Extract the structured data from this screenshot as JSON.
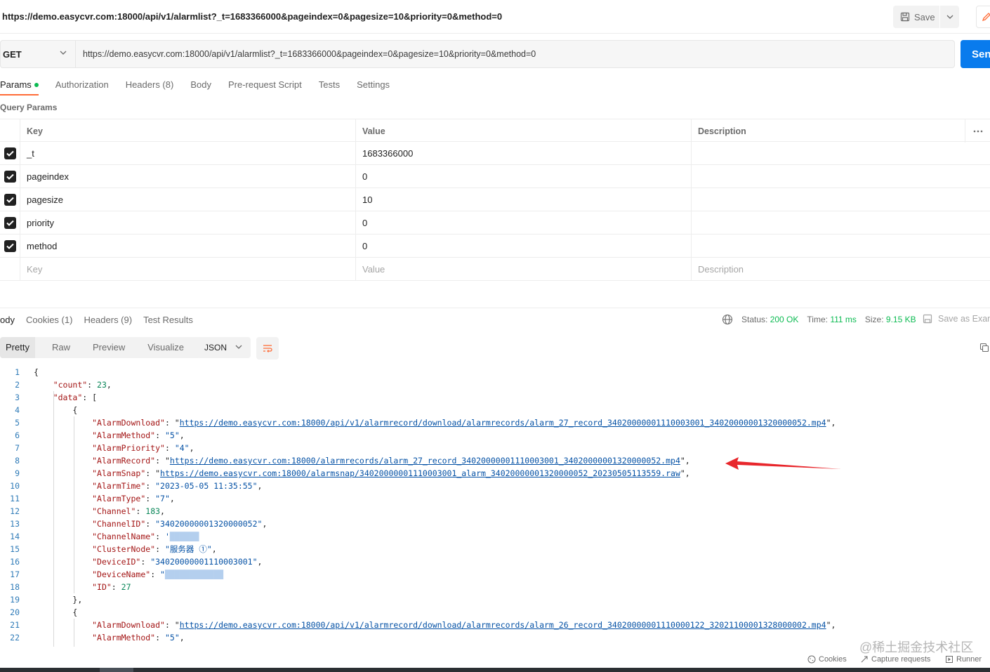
{
  "title_url": "https://demo.easycvr.com:18000/api/v1/alarmlist?_t=1683366000&pageindex=0&pagesize=10&priority=0&method=0",
  "toolbar": {
    "save_label": "Save"
  },
  "request": {
    "method": "GET",
    "url": "https://demo.easycvr.com:18000/api/v1/alarmlist?_t=1683366000&pageindex=0&pagesize=10&priority=0&method=0",
    "send_label": "Send"
  },
  "request_tabs": [
    "Params",
    "Authorization",
    "Headers (8)",
    "Body",
    "Pre-request Script",
    "Tests",
    "Settings"
  ],
  "query_params": {
    "title": "Query Params",
    "headers": {
      "key": "Key",
      "value": "Value",
      "description": "Description"
    },
    "rows": [
      {
        "key": "_t",
        "value": "1683366000"
      },
      {
        "key": "pageindex",
        "value": "0"
      },
      {
        "key": "pagesize",
        "value": "10"
      },
      {
        "key": "priority",
        "value": "0"
      },
      {
        "key": "method",
        "value": "0"
      }
    ],
    "placeholder": {
      "key": "Key",
      "value": "Value",
      "description": "Description"
    }
  },
  "response": {
    "tabs": [
      "ody",
      "Cookies (1)",
      "Headers (9)",
      "Test Results"
    ],
    "status_label": "Status:",
    "status_value": "200 OK",
    "time_label": "Time:",
    "time_value": "111 ms",
    "size_label": "Size:",
    "size_value": "9.15 KB",
    "save_example": "Save as Exam",
    "view_tabs": [
      "Pretty",
      "Raw",
      "Preview",
      "Visualize"
    ],
    "format": "JSON"
  },
  "code_lines": [
    {
      "n": "1",
      "indent": "",
      "tokens": [
        [
          "p",
          "{"
        ]
      ]
    },
    {
      "n": "2",
      "indent": "    ",
      "tokens": [
        [
          "k",
          "\"count\""
        ],
        [
          "p",
          ": "
        ],
        [
          "n",
          "23"
        ],
        [
          "p",
          ","
        ]
      ]
    },
    {
      "n": "3",
      "indent": "    ",
      "tokens": [
        [
          "k",
          "\"data\""
        ],
        [
          "p",
          ": ["
        ]
      ]
    },
    {
      "n": "4",
      "indent": "        ",
      "tokens": [
        [
          "p",
          "{"
        ]
      ]
    },
    {
      "n": "5",
      "indent": "            ",
      "tokens": [
        [
          "k",
          "\"AlarmDownload\""
        ],
        [
          "p",
          ": \""
        ],
        [
          "l",
          "https://demo.easycvr.com:18000/api/v1/alarmrecord/download/alarmrecords/alarm_27_record_34020000001110003001_34020000001320000052.mp4"
        ],
        [
          "p",
          "\","
        ]
      ]
    },
    {
      "n": "6",
      "indent": "            ",
      "tokens": [
        [
          "k",
          "\"AlarmMethod\""
        ],
        [
          "p",
          ": "
        ],
        [
          "s",
          "\"5\""
        ],
        [
          "p",
          ","
        ]
      ]
    },
    {
      "n": "7",
      "indent": "            ",
      "tokens": [
        [
          "k",
          "\"AlarmPriority\""
        ],
        [
          "p",
          ": "
        ],
        [
          "s",
          "\"4\""
        ],
        [
          "p",
          ","
        ]
      ]
    },
    {
      "n": "8",
      "indent": "            ",
      "tokens": [
        [
          "k",
          "\"AlarmRecord\""
        ],
        [
          "p",
          ": \""
        ],
        [
          "l",
          "https://demo.easycvr.com:18000/alarmrecords/alarm_27_record_34020000001110003001_34020000001320000052.mp4"
        ],
        [
          "p",
          "\","
        ]
      ]
    },
    {
      "n": "9",
      "indent": "            ",
      "tokens": [
        [
          "k",
          "\"AlarmSnap\""
        ],
        [
          "p",
          ": \""
        ],
        [
          "l",
          "https://demo.easycvr.com:18000/alarmsnap/34020000001110003001_alarm_34020000001320000052_20230505113559.raw"
        ],
        [
          "p",
          "\","
        ]
      ]
    },
    {
      "n": "10",
      "indent": "            ",
      "tokens": [
        [
          "k",
          "\"AlarmTime\""
        ],
        [
          "p",
          ": "
        ],
        [
          "s",
          "\"2023-05-05 11:35:55\""
        ],
        [
          "p",
          ","
        ]
      ]
    },
    {
      "n": "11",
      "indent": "            ",
      "tokens": [
        [
          "k",
          "\"AlarmType\""
        ],
        [
          "p",
          ": "
        ],
        [
          "s",
          "\"7\""
        ],
        [
          "p",
          ","
        ]
      ]
    },
    {
      "n": "12",
      "indent": "            ",
      "tokens": [
        [
          "k",
          "\"Channel\""
        ],
        [
          "p",
          ": "
        ],
        [
          "n",
          "183"
        ],
        [
          "p",
          ","
        ]
      ]
    },
    {
      "n": "13",
      "indent": "            ",
      "tokens": [
        [
          "k",
          "\"ChannelID\""
        ],
        [
          "p",
          ": "
        ],
        [
          "s",
          "\"34020000001320000052\""
        ],
        [
          "p",
          ","
        ]
      ]
    },
    {
      "n": "14",
      "indent": "            ",
      "tokens": [
        [
          "k",
          "\"ChannelName\""
        ],
        [
          "p",
          ": "
        ],
        [
          "s",
          "'"
        ],
        [
          "b",
          "██████"
        ]
      ]
    },
    {
      "n": "15",
      "indent": "            ",
      "tokens": [
        [
          "k",
          "\"ClusterNode\""
        ],
        [
          "p",
          ": "
        ],
        [
          "s",
          "\"服务器 ①\""
        ],
        [
          "p",
          ","
        ]
      ]
    },
    {
      "n": "16",
      "indent": "            ",
      "tokens": [
        [
          "k",
          "\"DeviceID\""
        ],
        [
          "p",
          ": "
        ],
        [
          "s",
          "\"34020000001110003001\""
        ],
        [
          "p",
          ","
        ]
      ]
    },
    {
      "n": "17",
      "indent": "            ",
      "tokens": [
        [
          "k",
          "\"DeviceName\""
        ],
        [
          "p",
          ": "
        ],
        [
          "s",
          "\""
        ],
        [
          "b",
          "████████████"
        ]
      ]
    },
    {
      "n": "18",
      "indent": "            ",
      "tokens": [
        [
          "k",
          "\"ID\""
        ],
        [
          "p",
          ": "
        ],
        [
          "n",
          "27"
        ]
      ]
    },
    {
      "n": "19",
      "indent": "        ",
      "tokens": [
        [
          "p",
          "},"
        ]
      ]
    },
    {
      "n": "20",
      "indent": "        ",
      "tokens": [
        [
          "p",
          "{"
        ]
      ]
    },
    {
      "n": "21",
      "indent": "            ",
      "tokens": [
        [
          "k",
          "\"AlarmDownload\""
        ],
        [
          "p",
          ": \""
        ],
        [
          "l",
          "https://demo.easycvr.com:18000/api/v1/alarmrecord/download/alarmrecords/alarm_26_record_34020000001110000122_32021100001328000002.mp4"
        ],
        [
          "p",
          "\","
        ]
      ]
    },
    {
      "n": "22",
      "indent": "            ",
      "tokens": [
        [
          "k",
          "\"AlarmMethod\""
        ],
        [
          "p",
          ": "
        ],
        [
          "s",
          "\"5\""
        ],
        [
          "p",
          ","
        ]
      ]
    }
  ],
  "watermark": "@稀土掘金技术社区",
  "footer": {
    "cookies": "Cookies",
    "capture": "Capture requests",
    "runner": "Runner"
  },
  "colors": {
    "accent": "#ff6c37",
    "send": "#097bed",
    "status_ok": "#0cbb52",
    "arrow": "#e8262b"
  },
  "icons": [
    "save-icon",
    "chevron-down-icon",
    "edit-icon",
    "checkbox-icon",
    "more-icon",
    "globe-icon",
    "save-example-icon",
    "wrap-lines-icon",
    "copy-icon",
    "cookie-icon",
    "capture-icon",
    "runner-icon"
  ]
}
